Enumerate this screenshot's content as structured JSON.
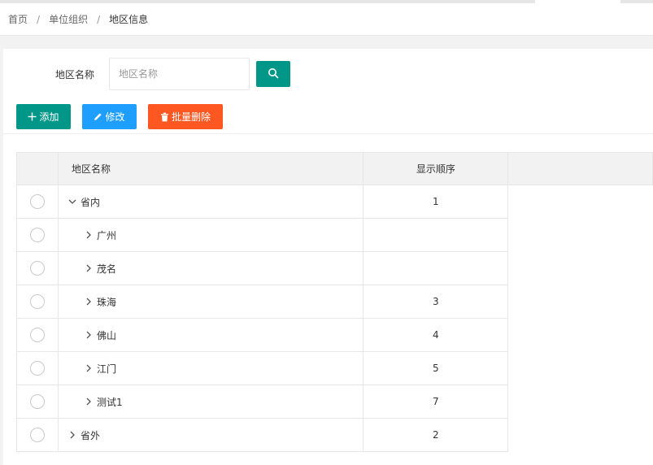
{
  "breadcrumb": {
    "items": [
      "首页",
      "单位组织"
    ],
    "current": "地区信息",
    "separator": "/"
  },
  "search": {
    "label": "地区名称",
    "placeholder": "地区名称",
    "value": "",
    "button_icon": "search-icon"
  },
  "toolbar": {
    "add_label": "添加",
    "edit_label": "修改",
    "delete_label": "批量删除"
  },
  "table": {
    "columns": [
      "地区名称",
      "显示顺序"
    ],
    "rows": [
      {
        "name": "省内",
        "order": "1",
        "level": 0,
        "expanded": true
      },
      {
        "name": "广州",
        "order": "",
        "level": 1,
        "expanded": false
      },
      {
        "name": "茂名",
        "order": "",
        "level": 1,
        "expanded": false
      },
      {
        "name": "珠海",
        "order": "3",
        "level": 1,
        "expanded": false
      },
      {
        "name": "佛山",
        "order": "4",
        "level": 1,
        "expanded": false
      },
      {
        "name": "江门",
        "order": "5",
        "level": 1,
        "expanded": false
      },
      {
        "name": "测试1",
        "order": "7",
        "level": 1,
        "expanded": false
      },
      {
        "name": "省外",
        "order": "2",
        "level": 0,
        "expanded": false
      }
    ]
  },
  "colors": {
    "primary": "#009688",
    "normal": "#1e9fff",
    "danger": "#ff5722"
  }
}
